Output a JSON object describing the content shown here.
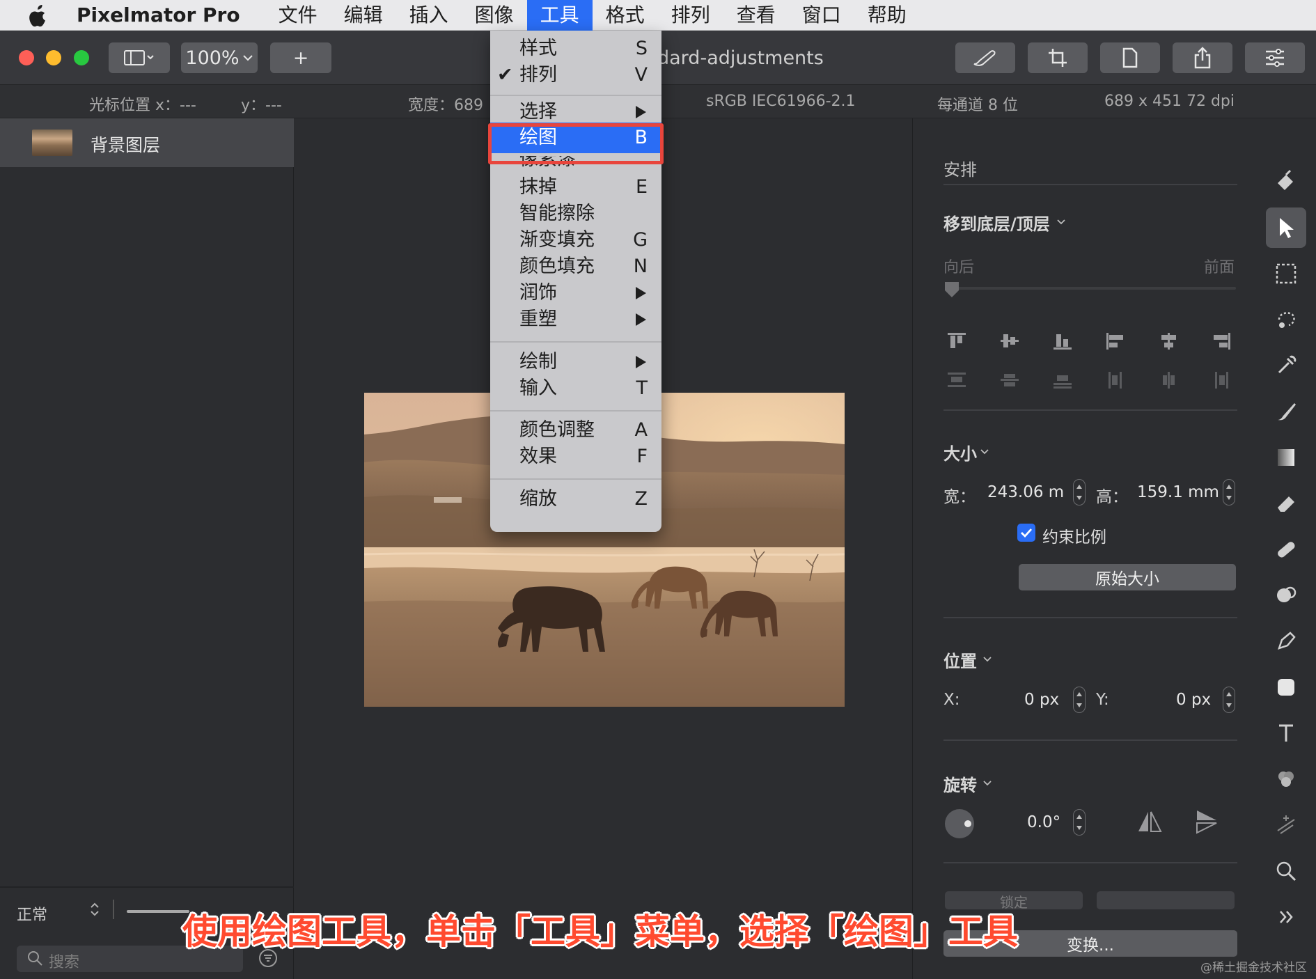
{
  "menubar": {
    "app_name": "Pixelmator Pro",
    "items": [
      "文件",
      "编辑",
      "插入",
      "图像",
      "工具",
      "格式",
      "排列",
      "查看",
      "窗口",
      "帮助"
    ],
    "active_item": "工具"
  },
  "toolbar": {
    "zoom": "100%",
    "add_label": "+",
    "document_title": "dard-adjustments"
  },
  "infobar": {
    "cursor_x": "光标位置 x：---",
    "cursor_y": "y：---",
    "width": "宽度：689",
    "color_profile": "sRGB IEC61966-2.1",
    "bit_depth": "每通道 8 位",
    "dimensions": "689 x 451 72 dpi"
  },
  "layers": {
    "items": [
      {
        "name": "背景图层"
      }
    ],
    "blend_mode": "正常",
    "search_placeholder": "搜索"
  },
  "tools_menu": {
    "items": [
      {
        "label": "样式",
        "shortcut": "S",
        "checked": false,
        "submenu": false
      },
      {
        "label": "排列",
        "shortcut": "V",
        "checked": true,
        "submenu": false
      },
      {
        "label": "选择",
        "shortcut": "",
        "checked": false,
        "submenu": true
      },
      {
        "label": "绘图",
        "shortcut": "B",
        "checked": false,
        "submenu": false,
        "highlighted": true
      },
      {
        "label": "像素漆",
        "shortcut": "",
        "checked": false,
        "submenu": false
      },
      {
        "label": "抹掉",
        "shortcut": "E",
        "checked": false,
        "submenu": false
      },
      {
        "label": "智能擦除",
        "shortcut": "",
        "checked": false,
        "submenu": false
      },
      {
        "label": "渐变填充",
        "shortcut": "G",
        "checked": false,
        "submenu": false
      },
      {
        "label": "颜色填充",
        "shortcut": "N",
        "checked": false,
        "submenu": false
      },
      {
        "label": "润饰",
        "shortcut": "",
        "checked": false,
        "submenu": true
      },
      {
        "label": "重塑",
        "shortcut": "",
        "checked": false,
        "submenu": true
      },
      {
        "label": "绘制",
        "shortcut": "",
        "checked": false,
        "submenu": true
      },
      {
        "label": "输入",
        "shortcut": "T",
        "checked": false,
        "submenu": false
      },
      {
        "label": "颜色调整",
        "shortcut": "A",
        "checked": false,
        "submenu": false
      },
      {
        "label": "效果",
        "shortcut": "F",
        "checked": false,
        "submenu": false
      },
      {
        "label": "缩放",
        "shortcut": "Z",
        "checked": false,
        "submenu": false
      }
    ]
  },
  "inspector": {
    "arrange_title": "安排",
    "move_section": "移到底层/顶层",
    "back_label": "向后",
    "front_label": "前面",
    "size_section": "大小",
    "width_label": "宽：",
    "width_value": "243.06 m",
    "height_label": "高：",
    "height_value": "159.1 mm",
    "constrain_label": "约束比例",
    "constrain_checked": true,
    "original_size_button": "原始大小",
    "position_section": "位置",
    "x_label": "X:",
    "x_value": "0 px",
    "y_label": "Y:",
    "y_value": "0 px",
    "rotate_section": "旋转",
    "rotate_value": "0.0°",
    "lock_button": "锁定",
    "transform_button": "变换..."
  },
  "caption": "使用绘图工具，单击「工具」菜单，选择「绘图」工具",
  "watermark": "@稀土掘金技术社区",
  "colors": {
    "accent": "#2a6df5",
    "highlight_box": "#e8453c",
    "caption": "#ff4a2f"
  }
}
